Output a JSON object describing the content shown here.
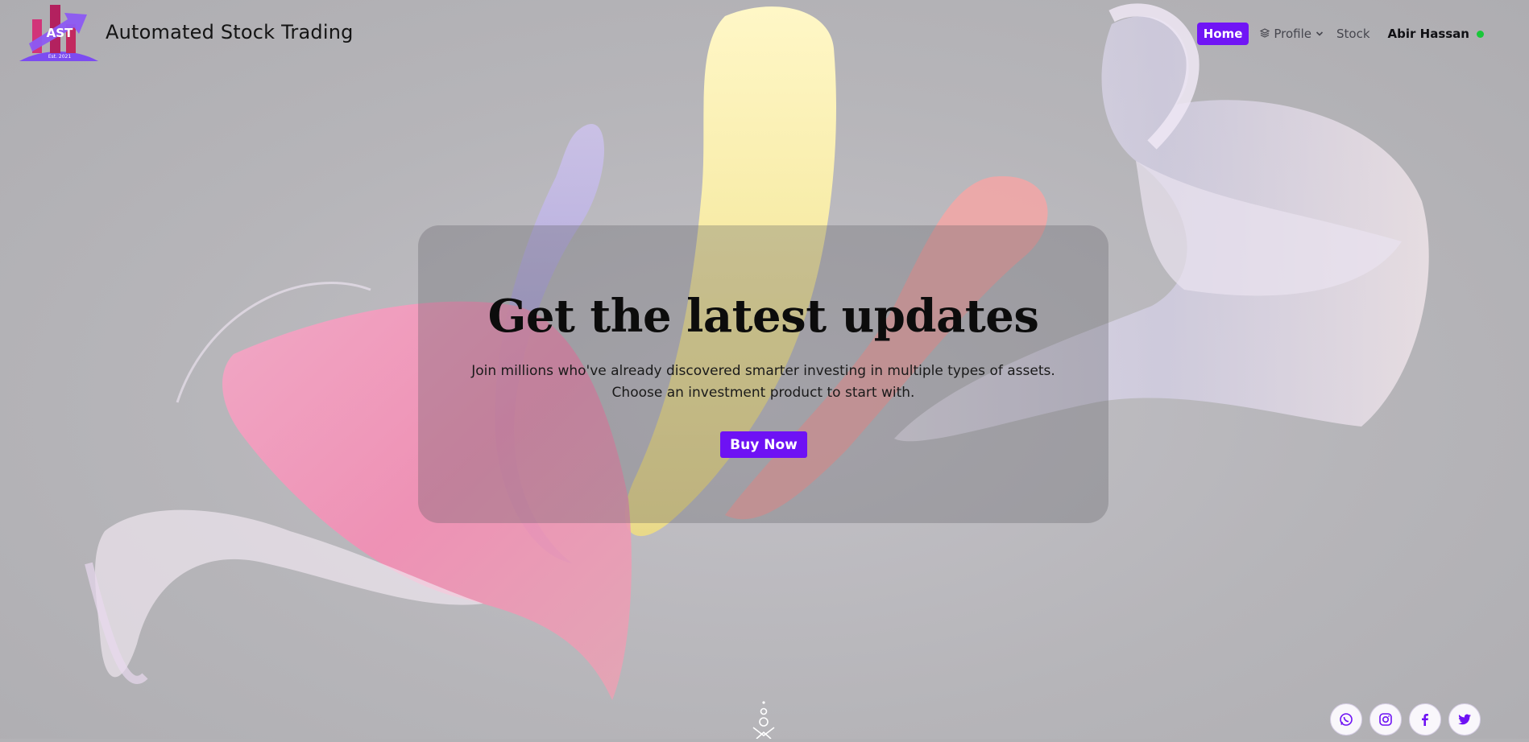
{
  "brand": {
    "logo_text": "AST",
    "logo_sub": "Est. 2021",
    "title": "Automated Stock Trading"
  },
  "nav": {
    "home": "Home",
    "profile": "Profile",
    "stock": "Stock",
    "user": "Abir Hassan",
    "online_color": "#19c739"
  },
  "hero": {
    "headline": "Get the latest updates",
    "line1": "Join millions who've already discovered smarter investing in multiple types of assets.",
    "line2": "Choose an investment product to start with.",
    "button": "Buy Now"
  },
  "social": {
    "icons": [
      "whatsapp-icon",
      "instagram-icon",
      "facebook-icon",
      "twitter-icon"
    ]
  },
  "colors": {
    "accent": "#6e12f4",
    "background": "#b3b2b6"
  }
}
